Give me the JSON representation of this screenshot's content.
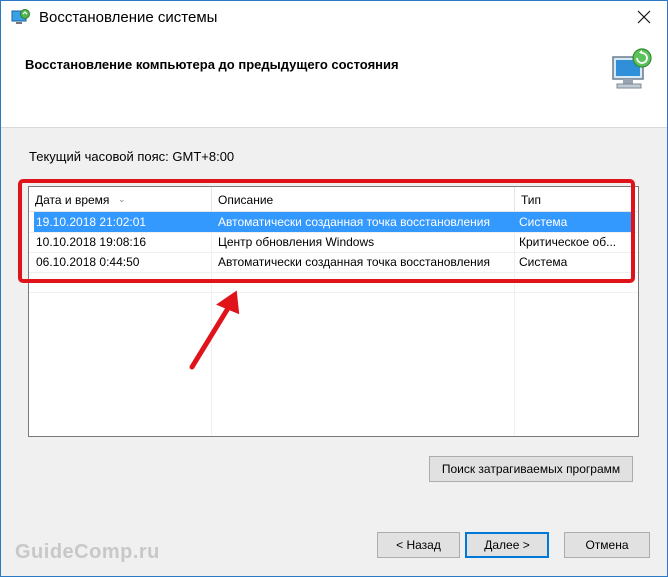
{
  "window": {
    "title": "Восстановление системы"
  },
  "header": {
    "heading": "Восстановление компьютера до предыдущего состояния"
  },
  "timezone_text": "Текущий часовой пояс: GMT+8:00",
  "table": {
    "columns": [
      "Дата и время",
      "Описание",
      "Тип"
    ],
    "rows": [
      [
        "19.10.2018 21:02:01",
        "Автоматически созданная точка восстановления",
        "Система"
      ],
      [
        "10.10.2018 19:08:16",
        "Центр обновления Windows",
        "Критическое об..."
      ],
      [
        "06.10.2018 0:44:50",
        "Автоматически созданная точка восстановления",
        "Система"
      ]
    ],
    "selected_row": 0
  },
  "buttons": {
    "scan": "Поиск затрагиваемых программ",
    "back": "< Назад",
    "next": "Далее >",
    "cancel": "Отмена"
  },
  "watermark": "GuideComp.ru",
  "colors": {
    "selection": "#3399ff",
    "highlight_border": "#e0131b",
    "accent": "#0078d7"
  },
  "icons": [
    "system-restore-icon",
    "close-icon",
    "restore-computer-icon",
    "sort-arrow-icon",
    "red-arrow"
  ]
}
